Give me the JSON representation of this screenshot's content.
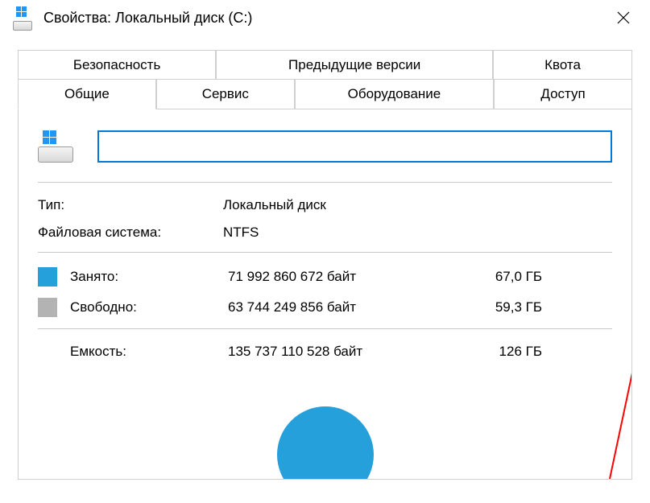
{
  "window": {
    "title": "Свойства: Локальный диск (C:)"
  },
  "tabs_back": [
    {
      "label": "Безопасность"
    },
    {
      "label": "Предыдущие версии"
    },
    {
      "label": "Квота"
    }
  ],
  "tabs_front": [
    {
      "label": "Общие"
    },
    {
      "label": "Сервис"
    },
    {
      "label": "Оборудование"
    },
    {
      "label": "Доступ"
    }
  ],
  "general": {
    "name_value": "",
    "type_label": "Тип:",
    "type_value": "Локальный диск",
    "fs_label": "Файловая система:",
    "fs_value": "NTFS",
    "used_label": "Занято:",
    "used_bytes": "71 992 860 672 байт",
    "used_gb": "67,0 ГБ",
    "free_label": "Свободно:",
    "free_bytes": "63 744 249 856 байт",
    "free_gb": "59,3 ГБ",
    "capacity_label": "Емкость:",
    "capacity_bytes": "135 737 110 528 байт",
    "capacity_gb": "126 ГБ"
  },
  "colors": {
    "used": "#26a0da",
    "free": "#b3b3b3",
    "accent": "#0078d7"
  }
}
